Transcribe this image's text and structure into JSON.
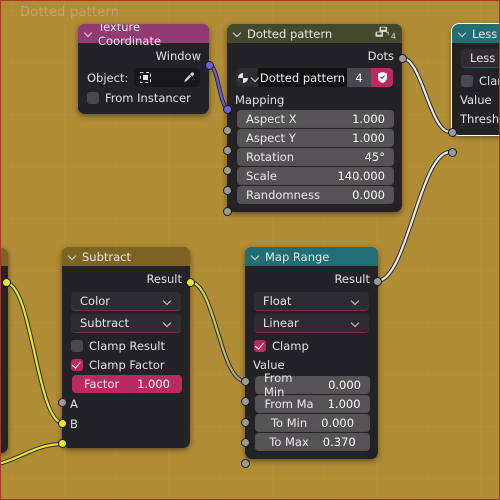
{
  "editor": {
    "frame_label": "Dotted pattern",
    "background_color": "#b08c35",
    "border_color": "#a33a24"
  },
  "nodes": [
    {
      "id": "texture-coordinate",
      "title": "Texture Coordinate",
      "header_color": "#913a73",
      "outputs": [
        "Window"
      ],
      "object_label": "Object:",
      "object_value": "",
      "object_icon": "object-icon",
      "eyedropper_icon": "eyedropper-icon",
      "from_instancer_label": "From Instancer",
      "from_instancer_checked": false
    },
    {
      "id": "dotted-pattern-group",
      "title": "Dotted pattern",
      "header_color": "#434a2b",
      "users_count": "4",
      "users_icon": "copy-users-icon",
      "outputs": [
        "Dots"
      ],
      "datablock": {
        "browse_icon": "texture-browse-icon",
        "name": "Dotted pattern",
        "users": "4",
        "fake_user_icon": "shield-icon",
        "fake_user_on": true
      },
      "mapping_label": "Mapping",
      "fields": [
        {
          "label": "Aspect X",
          "value": "1.000"
        },
        {
          "label": "Aspect Y",
          "value": "1.000"
        },
        {
          "label": "Rotation",
          "value": "45°"
        },
        {
          "label": "Scale",
          "value": "140.000"
        },
        {
          "label": "Randomness",
          "value": "0.000"
        }
      ]
    },
    {
      "id": "less-than",
      "title": "Less Than",
      "header_color": "#1f6f74",
      "selected": true,
      "operation": "Less Than",
      "clamp_label": "Clamp",
      "clamp_checked": false,
      "inputs": [
        "Value",
        "Threshold"
      ]
    },
    {
      "id": "subtract",
      "title": "Subtract",
      "header_color": "#7d6425",
      "outputs": [
        "Result"
      ],
      "data_type": "Color",
      "blend_mode": "Subtract",
      "clamp_result_label": "Clamp Result",
      "clamp_result_checked": false,
      "clamp_factor_label": "Clamp Factor",
      "clamp_factor_checked": true,
      "factor_label": "Factor",
      "factor_value": "1.000",
      "inputs": [
        "A",
        "B"
      ]
    },
    {
      "id": "map-range",
      "title": "Map Range",
      "header_color": "#1f6f74",
      "outputs": [
        "Result"
      ],
      "data_type": "Float",
      "interpolation": "Linear",
      "clamp_label": "Clamp",
      "clamp_checked": true,
      "value_label": "Value",
      "fields": [
        {
          "label": "From Min",
          "value": "0.000"
        },
        {
          "label": "From Ma",
          "value": "1.000"
        },
        {
          "label": "To Min",
          "value": "0.000"
        },
        {
          "label": "To Max",
          "value": "0.370"
        }
      ]
    }
  ],
  "socket_colors": {
    "vector": "#6a61e0",
    "value": "#9a9a9a",
    "color": "#e8e82a"
  }
}
